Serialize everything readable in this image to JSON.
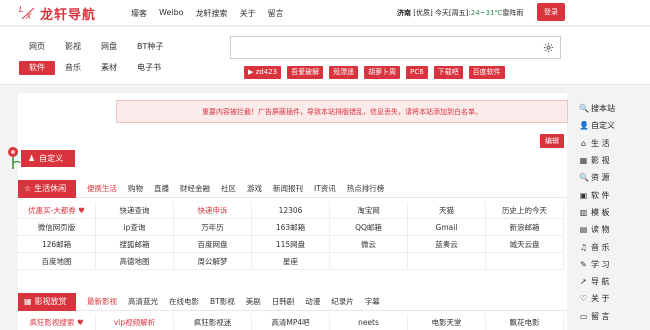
{
  "header": {
    "logo_text": "龙轩导航",
    "nav": [
      "壕客",
      "Weibo",
      "龙轩搜索",
      "关于",
      "留言"
    ],
    "weather": {
      "city": "济南",
      "air": "[优质]",
      "today_label": "今天[周五]:",
      "temp": "24~31℃",
      "cond": "雷阵雨"
    },
    "login_label": "登录"
  },
  "search": {
    "tabs_row1": [
      "网页",
      "影视",
      "网盘",
      "BT种子"
    ],
    "tabs_row2": [
      "软件",
      "音乐",
      "素材",
      "电子书"
    ],
    "active_tab": "软件",
    "placeholder": "",
    "quick_links": [
      "▶ zd423",
      "吾爱破解",
      "殁漂遥",
      "胡萝卜周",
      "PC6",
      "下载吧",
      "百度软件"
    ]
  },
  "notice": "重要内容被拦截！广告屏蔽插件，导致本站排版错乱，信息丢失，请将本站添加到白名单。",
  "edit_label": "编辑",
  "custom_label": "自定义",
  "sections": [
    {
      "label": "生活休闲",
      "subtabs": [
        "便携生活",
        "购物",
        "直播",
        "财经金融",
        "社区",
        "游戏",
        "新闻报刊",
        "IT资讯",
        "热点排行榜"
      ],
      "active_sub": 0,
      "rows": [
        [
          "优惠买-大都券 ♥",
          "快递查询",
          "快递申诉",
          "12306",
          "淘宝网",
          "天猫",
          "历史上的今天"
        ],
        [
          "微信网页版",
          "ip查询",
          "万年历",
          "163邮箱",
          "QQ邮箱",
          "Gmail",
          "新浪邮箱"
        ],
        [
          "126邮箱",
          "搜狐邮箱",
          "百度网盘",
          "115网盘",
          "微云",
          "蓝奏云",
          "城天云盘"
        ],
        [
          "百度地图",
          "高德地图",
          "周公解梦",
          "星座",
          "",
          "",
          ""
        ]
      ],
      "red_cells": [
        "优惠买-大都券 ♥",
        "快递申诉"
      ]
    },
    {
      "label": "影视放赏",
      "subtabs": [
        "最新影视",
        "高清蓝光",
        "在线电影",
        "BT影视",
        "美剧",
        "日韩剧",
        "动漫",
        "纪录片",
        "字幕"
      ],
      "active_sub": 0,
      "rows": [
        [
          "疯狂影视搜索 ♥",
          "vip视频解析",
          "疯狂影视迷",
          "高清MP4吧",
          "neets",
          "电影天堂",
          "飘花电影"
        ]
      ],
      "red_cells": [
        "疯狂影视搜索 ♥",
        "vip视频解析"
      ]
    }
  ],
  "sidebar": [
    {
      "icon": "search-icon",
      "glyph": "🔍",
      "label": "搜本站"
    },
    {
      "icon": "user-icon",
      "glyph": "👤",
      "label": "自定义"
    },
    {
      "icon": "home-icon",
      "glyph": "⌂",
      "label": "生 活"
    },
    {
      "icon": "film-icon",
      "glyph": "▦",
      "label": "影 视"
    },
    {
      "icon": "search-icon",
      "glyph": "🔍",
      "label": "资 源"
    },
    {
      "icon": "box-icon",
      "glyph": "▣",
      "label": "软 件"
    },
    {
      "icon": "grid-icon",
      "glyph": "▥",
      "label": "模 板"
    },
    {
      "icon": "book-icon",
      "glyph": "▤",
      "label": "读 物"
    },
    {
      "icon": "music-icon",
      "glyph": "♫",
      "label": "音 乐"
    },
    {
      "icon": "graduation-icon",
      "glyph": "✎",
      "label": "学 习"
    },
    {
      "icon": "nav-icon",
      "glyph": "➚",
      "label": "导 航"
    },
    {
      "icon": "heart-icon",
      "glyph": "♡",
      "label": "关 于"
    },
    {
      "icon": "comment-icon",
      "glyph": "▭",
      "label": "留 言"
    }
  ],
  "colors": {
    "accent": "#d9343d",
    "notice_bg": "#fbeaea"
  }
}
